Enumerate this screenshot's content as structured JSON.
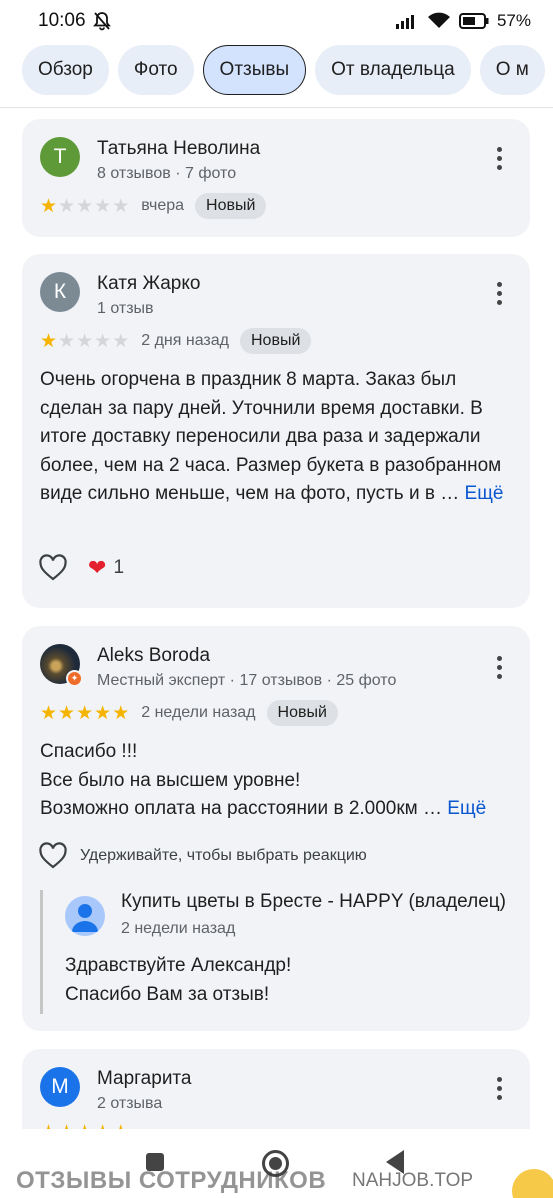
{
  "status": {
    "time": "10:06",
    "battery": "57%"
  },
  "tabs": [
    {
      "label": "Обзор"
    },
    {
      "label": "Фото"
    },
    {
      "label": "Отзывы"
    },
    {
      "label": "От владельца"
    },
    {
      "label": "О м"
    }
  ],
  "reviews": [
    {
      "initial": "Т",
      "avatar_color": "#5e9a37",
      "name": "Татьяна Неволина",
      "meta": "8 отзывов · 7 фото",
      "stars": 1,
      "when": "вчера",
      "badge": "Новый"
    },
    {
      "initial": "К",
      "avatar_color": "#7b8a93",
      "name": "Катя Жарко",
      "meta": "1 отзыв",
      "stars": 1,
      "when": "2 дня назад",
      "badge": "Новый",
      "text": "Очень огорчена в праздник 8 марта. Заказ был сделан за пару дней. Уточнили время доставки. В итоге доставку переносили два раза и задержали более, чем на 2 часа. Размер букета в разобранном виде сильно меньше, чем на фото, пусть и в … ",
      "more_link": "Ещё",
      "reaction_count": "1"
    },
    {
      "name": "Aleks Boroda",
      "meta": "Местный эксперт · 17 отзывов · 25 фото",
      "stars": 5,
      "when": "2 недели назад",
      "badge": "Новый",
      "text_lines": [
        "Спасибо !!!",
        "Все было на высшем уровне!",
        "Возможно оплата на расстоянии в 2.000км … "
      ],
      "more_link": "Ещё",
      "reaction_hint": "Удерживайте, чтобы выбрать реакцию",
      "owner_reply": {
        "name": "Купить цветы в Бресте - HAPPY (владелец)",
        "when": "2 недели назад",
        "lines": [
          "Здравствуйте Александр!",
          "Спасибо Вам за отзыв!"
        ]
      }
    },
    {
      "initial": "М",
      "avatar_color": "#1a73e8",
      "name": "Маргарита",
      "meta": "2 отзыва"
    }
  ],
  "watermark": {
    "left": "ОТЗЫВЫ СОТРУДНИКОВ",
    "right": "NAHJOB.TOP"
  }
}
